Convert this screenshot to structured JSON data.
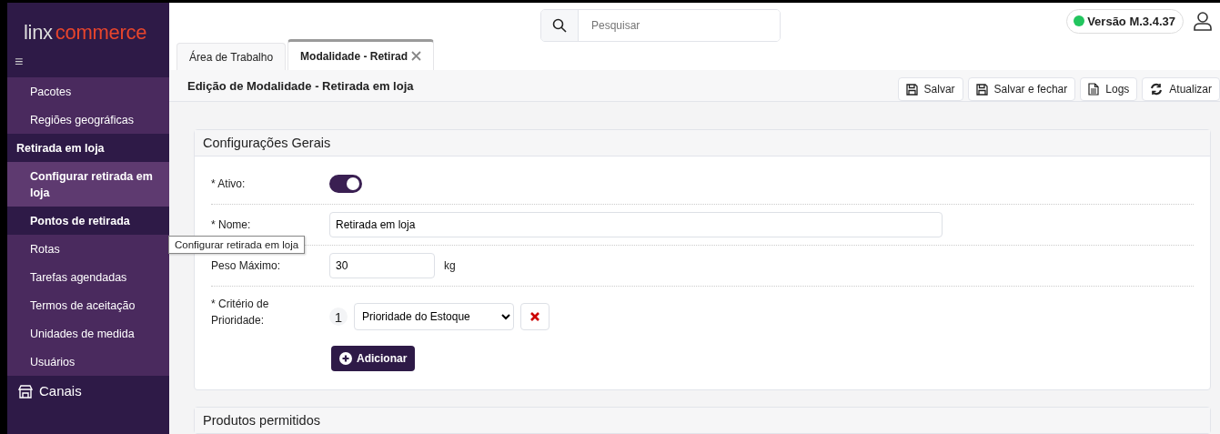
{
  "logo": {
    "part_1": "linx",
    "part_2": "commerce"
  },
  "menu_glyph": "≡",
  "sidebar": {
    "items": [
      {
        "kind": "item",
        "label": "Pacotes",
        "selected": false,
        "hovered": false
      },
      {
        "kind": "item",
        "label": "Regiões geográficas",
        "selected": false,
        "hovered": false
      },
      {
        "kind": "group",
        "label": "Retirada em loja",
        "selected": false,
        "hovered": false
      },
      {
        "kind": "item",
        "label": "Configurar retirada em loja",
        "selected": true,
        "hovered": false
      },
      {
        "kind": "item",
        "label": "Pontos de retirada",
        "selected": false,
        "hovered": true
      },
      {
        "kind": "item",
        "label": "Rotas",
        "selected": false,
        "hovered": false
      },
      {
        "kind": "item",
        "label": "Tarefas agendadas",
        "selected": false,
        "hovered": false
      },
      {
        "kind": "item",
        "label": "Termos de aceitação",
        "selected": false,
        "hovered": false
      },
      {
        "kind": "item",
        "label": "Unidades de medida",
        "selected": false,
        "hovered": false
      },
      {
        "kind": "item",
        "label": "Usuários",
        "selected": false,
        "hovered": false
      },
      {
        "kind": "section",
        "label": "Canais",
        "selected": false,
        "hovered": false
      }
    ]
  },
  "tooltip": "Configurar retirada em loja",
  "search": {
    "placeholder": "Pesquisar"
  },
  "version": {
    "label": "Versão M.3.4.37",
    "online": true
  },
  "tabs": [
    {
      "label": "Área de Trabalho",
      "selected": false,
      "closable": false
    },
    {
      "label": "Modalidade - Retirad",
      "selected": true,
      "closable": true
    }
  ],
  "page_title": "Edição de Modalidade - Retirada em loja",
  "toolbar": [
    {
      "kind": "save",
      "label": "Salvar"
    },
    {
      "kind": "save",
      "label": "Salvar e fechar"
    },
    {
      "kind": "doc",
      "label": "Logs"
    },
    {
      "kind": "refresh",
      "label": "Atualizar"
    }
  ],
  "card": {
    "title": "Configurações Gerais",
    "active": {
      "label": "* Ativo:",
      "on": true
    },
    "name": {
      "label": "* Nome:",
      "value": "Retirada em loja"
    },
    "weight": {
      "label": "Peso Máximo:",
      "value": "30",
      "unit": "kg"
    },
    "priority": {
      "label": "* Critério de Prioridade:",
      "items": [
        {
          "index": "1",
          "value": "Prioridade do Estoque"
        }
      ]
    },
    "add_button": "Adicionar"
  },
  "next_card": {
    "title": "Produtos permitidos"
  }
}
